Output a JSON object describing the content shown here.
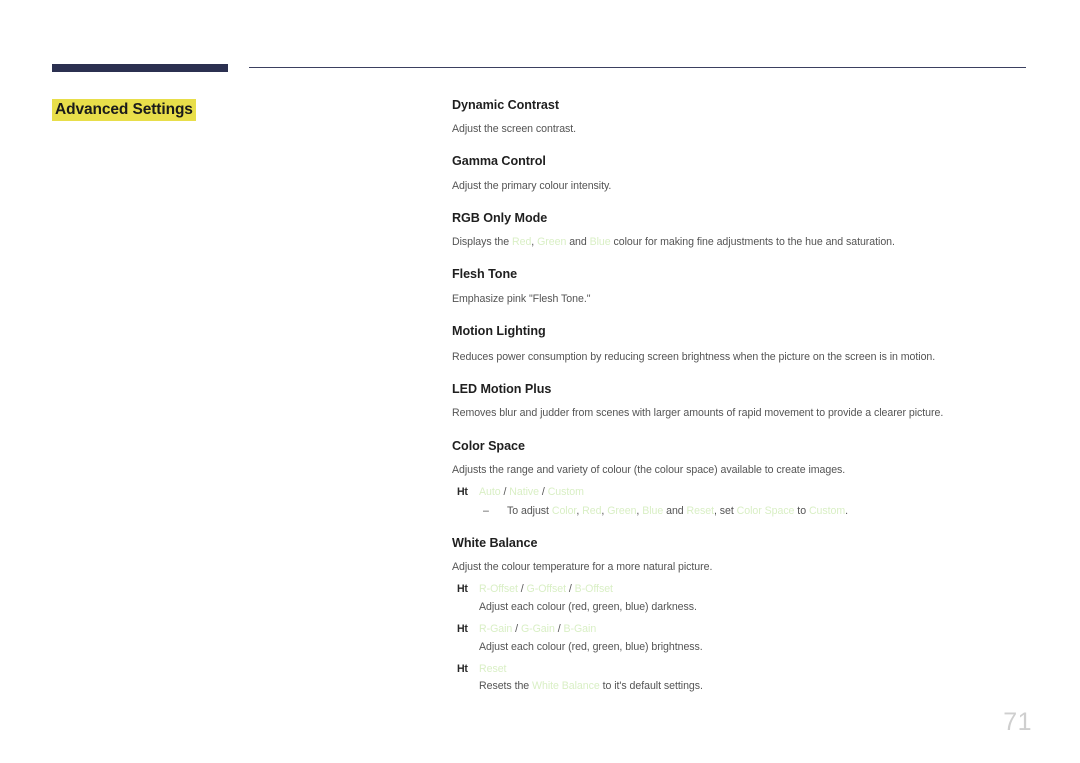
{
  "header": {
    "rule_thick_color": "#2b3050",
    "rule_thin_color": "#3b4060"
  },
  "section": {
    "title": "Advanced Settings",
    "highlight_color": "#e8de4a"
  },
  "colors": {
    "term_green": "#d9efc5",
    "heading": "#1f1f1f",
    "body": "#545454",
    "page_number": "#cfcfcf"
  },
  "bullet_marker": "Ht",
  "sub_marker": "–",
  "entries": [
    {
      "title": "Dynamic Contrast",
      "desc": "Adjust the screen contrast."
    },
    {
      "title": "Gamma Control",
      "desc": "Adjust the primary colour intensity."
    },
    {
      "title": "RGB Only Mode",
      "desc_parts": [
        {
          "text": "Displays the ",
          "term": false
        },
        {
          "text": "Red",
          "term": true
        },
        {
          "text": ", ",
          "term": false
        },
        {
          "text": "Green",
          "term": true
        },
        {
          "text": " and ",
          "term": false
        },
        {
          "text": "Blue",
          "term": true
        },
        {
          "text": " colour for making fine adjustments to the hue and saturation.",
          "term": false
        }
      ]
    },
    {
      "title": "Flesh Tone",
      "desc": "Emphasize pink \"Flesh Tone.\""
    },
    {
      "title": "Motion Lighting",
      "desc": "Reduces power consumption by reducing screen brightness when the picture on the screen is in motion."
    },
    {
      "title": "LED Motion Plus",
      "desc": "Removes blur and judder from scenes with larger amounts of rapid movement to provide a clearer picture."
    },
    {
      "title": "Color Space",
      "desc": "Adjusts the range and variety of colour (the colour space) available to create images."
    },
    {
      "title": "White Balance",
      "desc": "Adjust the colour temperature for a more natural picture."
    }
  ],
  "color_space": {
    "options": [
      {
        "text": "Auto",
        "term": true
      },
      {
        "text": " / ",
        "term": false
      },
      {
        "text": "Native",
        "term": true
      },
      {
        "text": " / ",
        "term": false
      },
      {
        "text": "Custom",
        "term": true
      }
    ],
    "note": [
      {
        "text": "To adjust ",
        "term": false
      },
      {
        "text": "Color",
        "term": true
      },
      {
        "text": ", ",
        "term": false
      },
      {
        "text": "Red",
        "term": true
      },
      {
        "text": ", ",
        "term": false
      },
      {
        "text": "Green",
        "term": true
      },
      {
        "text": ", ",
        "term": false
      },
      {
        "text": "Blue",
        "term": true
      },
      {
        "text": " and ",
        "term": false
      },
      {
        "text": "Reset",
        "term": true
      },
      {
        "text": ", set ",
        "term": false
      },
      {
        "text": "Color Space",
        "term": true
      },
      {
        "text": " to ",
        "term": false
      },
      {
        "text": "Custom",
        "term": true
      },
      {
        "text": ".",
        "term": false
      }
    ]
  },
  "white_balance": {
    "items": [
      {
        "label": [
          {
            "text": "R-Offset",
            "term": true
          },
          {
            "text": " / ",
            "term": false
          },
          {
            "text": "G-Offset",
            "term": true
          },
          {
            "text": " / ",
            "term": false
          },
          {
            "text": "B-Offset",
            "term": true
          }
        ],
        "desc": [
          {
            "text": "Adjust each colour (red, green, blue) darkness.",
            "term": false
          }
        ]
      },
      {
        "label": [
          {
            "text": "R-Gain",
            "term": true
          },
          {
            "text": " / ",
            "term": false
          },
          {
            "text": "G-Gain",
            "term": true
          },
          {
            "text": " / ",
            "term": false
          },
          {
            "text": "B-Gain",
            "term": true
          }
        ],
        "desc": [
          {
            "text": "Adjust each colour (red, green, blue) brightness.",
            "term": false
          }
        ]
      },
      {
        "label": [
          {
            "text": "Reset",
            "term": true
          }
        ],
        "desc": [
          {
            "text": "Resets the ",
            "term": false
          },
          {
            "text": "White Balance",
            "term": true
          },
          {
            "text": " to it's default settings.",
            "term": false
          }
        ]
      }
    ]
  },
  "page_number": "71"
}
